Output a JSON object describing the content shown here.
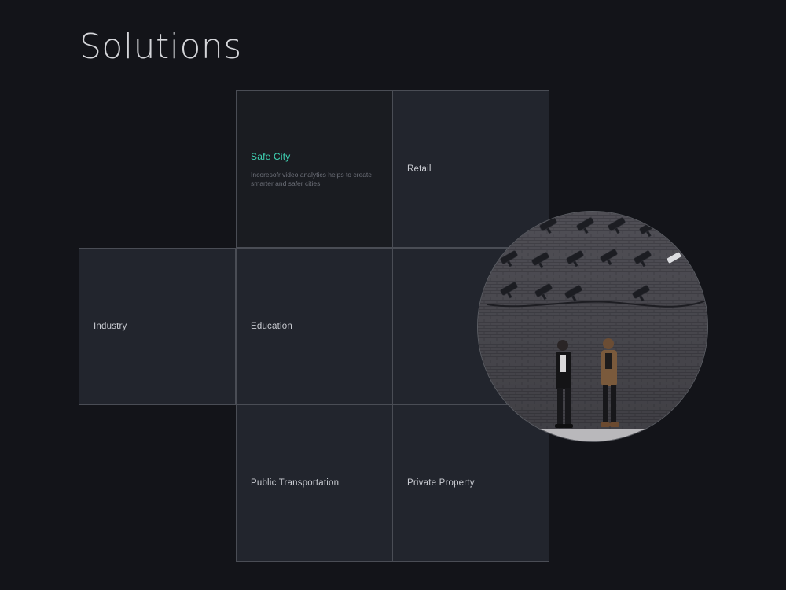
{
  "page": {
    "title": "Solutions"
  },
  "tiles": {
    "safe_city": {
      "label": "Safe City",
      "description": "Incoresofr video analytics helps to create smarter and safer cities"
    },
    "retail": {
      "label": "Retail"
    },
    "industry": {
      "label": "Industry"
    },
    "education": {
      "label": "Education"
    },
    "public_transportation": {
      "label": "Public Transportation"
    },
    "private_property": {
      "label": "Private Property"
    }
  },
  "colors": {
    "background": "#131419",
    "tile": "#22252d",
    "tile_active": "#1a1c21",
    "accent": "#3fd3b4",
    "border": "#4a4d55"
  },
  "image": {
    "subject": "two-people-under-cctv-cameras-photo"
  }
}
